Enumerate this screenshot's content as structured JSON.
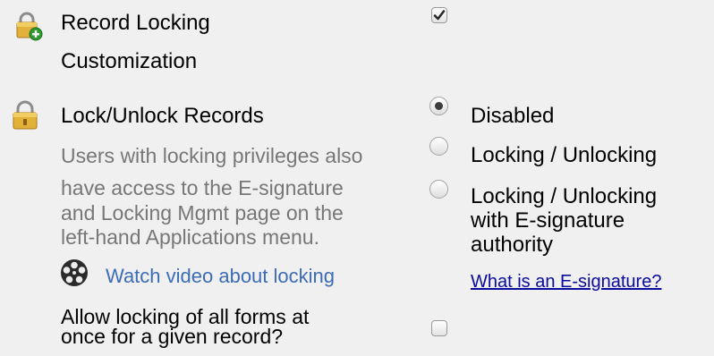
{
  "record_locking_customization": {
    "label_line1": "Record Locking",
    "label_line2": "Customization",
    "checked": true,
    "icon": "lock-add-icon"
  },
  "lock_unlock_records": {
    "label": "Lock/Unlock Records",
    "icon": "lock-icon",
    "description_lines": [
      "Users with locking privileges also",
      "have access to the E-signature",
      "and Locking Mgmt page on the",
      "left-hand Applications menu."
    ],
    "video_link": "Watch video about locking",
    "video_icon": "film-reel-icon",
    "options": [
      {
        "label": "Disabled",
        "selected": true
      },
      {
        "label": "Locking / Unlocking",
        "selected": false
      },
      {
        "label_lines": [
          "Locking / Unlocking",
          "with E-signature",
          "authority"
        ],
        "selected": false
      }
    ],
    "esignature_help_link": "What is an E-signature?"
  },
  "allow_locking_all_forms": {
    "label_lines": [
      "Allow locking of all forms at",
      "once for a given record?"
    ],
    "checked": false
  },
  "colors": {
    "background": "#f0f0f0",
    "description_text": "#777777",
    "video_link": "#3b6cb5",
    "help_link": "#0b0b9e"
  }
}
